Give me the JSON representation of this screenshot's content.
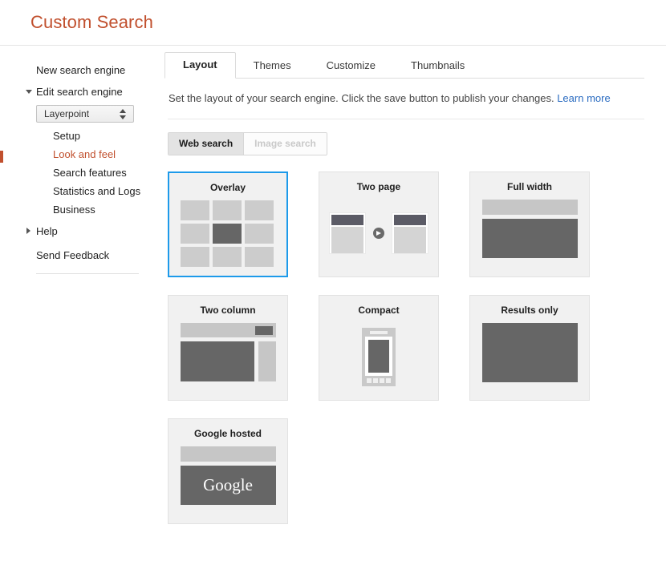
{
  "header": {
    "title": "Custom Search"
  },
  "sidebar": {
    "new_search_engine": "New search engine",
    "edit_search_engine": "Edit search engine",
    "engine_select": {
      "value": "Layerpoint",
      "options": [
        "Layerpoint"
      ]
    },
    "sub_items": [
      {
        "label": "Setup",
        "active": false
      },
      {
        "label": "Look and feel",
        "active": true
      },
      {
        "label": "Search features",
        "active": false
      },
      {
        "label": "Statistics and Logs",
        "active": false
      },
      {
        "label": "Business",
        "active": false
      }
    ],
    "help": "Help",
    "send_feedback": "Send Feedback"
  },
  "main": {
    "tabs": [
      {
        "label": "Layout",
        "active": true
      },
      {
        "label": "Themes",
        "active": false
      },
      {
        "label": "Customize",
        "active": false
      },
      {
        "label": "Thumbnails",
        "active": false
      }
    ],
    "description": "Set the layout of your search engine. Click the save button to publish your changes.",
    "learn_more": "Learn more",
    "mode_toggle": [
      {
        "label": "Web search",
        "state": "selected"
      },
      {
        "label": "Image search",
        "state": "disabled"
      }
    ],
    "layout_options": [
      {
        "label": "Overlay",
        "selected": true
      },
      {
        "label": "Two page",
        "selected": false
      },
      {
        "label": "Full width",
        "selected": false
      },
      {
        "label": "Two column",
        "selected": false
      },
      {
        "label": "Compact",
        "selected": false
      },
      {
        "label": "Results only",
        "selected": false
      },
      {
        "label": "Google hosted",
        "selected": false
      }
    ],
    "google_logo_text": "Google"
  },
  "colors": {
    "brand_orange": "#c1502e",
    "link_blue": "#2b6cc1",
    "selected_border_blue": "#1d9aea",
    "thumb_dark": "#666666",
    "thumb_light": "#c6c6c6"
  }
}
